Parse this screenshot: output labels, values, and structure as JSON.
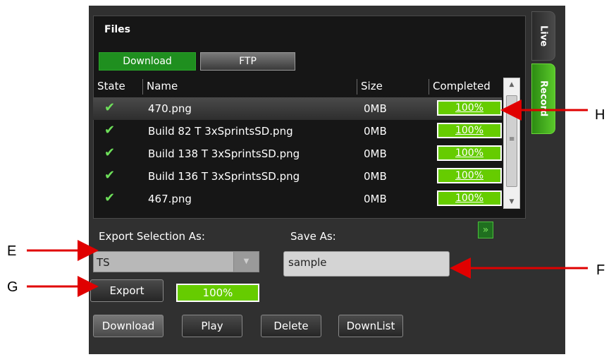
{
  "files_panel": {
    "title": "Files",
    "tabs": {
      "download": "Download",
      "ftp": "FTP"
    },
    "side_tabs": {
      "live": "Live",
      "record": "Record"
    },
    "columns": {
      "state": "State",
      "name": "Name",
      "size": "Size",
      "completed": "Completed"
    },
    "rows": [
      {
        "state_icon": "check-icon",
        "name": "470.png",
        "size": "0MB",
        "completed": "100%",
        "selected": true
      },
      {
        "state_icon": "check-icon",
        "name": "Build 82 T 3xSprintsSD.png",
        "size": "0MB",
        "completed": "100%"
      },
      {
        "state_icon": "check-icon",
        "name": "Build 138 T 3xSprintsSD.png",
        "size": "0MB",
        "completed": "100%"
      },
      {
        "state_icon": "check-icon",
        "name": "Build 136 T 3xSprintsSD.png",
        "size": "0MB",
        "completed": "100%"
      },
      {
        "state_icon": "check-icon",
        "name": "467.png",
        "size": "0MB",
        "completed": "100%"
      }
    ]
  },
  "export": {
    "label": "Export Selection As:",
    "format_value": "TS",
    "button": "Export",
    "progress": "100%"
  },
  "save_as": {
    "label": "Save As:",
    "value": "sample"
  },
  "actions": {
    "download": "Download",
    "play": "Play",
    "delete": "Delete",
    "downlist": "DownList"
  },
  "annotations": {
    "E": "E",
    "F": "F",
    "G": "G",
    "H": "H"
  },
  "colors": {
    "accent_green": "#66cc00",
    "tab_green": "#1f8f1f",
    "arrow_red": "#e00000",
    "panel_bg": "#303030"
  }
}
